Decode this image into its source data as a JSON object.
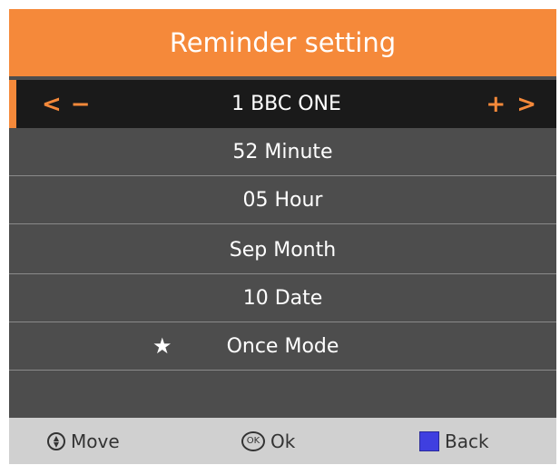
{
  "header": {
    "title": "Reminder setting"
  },
  "rows": {
    "channel": {
      "label": "1 BBC ONE",
      "left_arrow": "<",
      "left_minus": "−",
      "right_plus": "+",
      "right_arrow": ">"
    },
    "minute": "52 Minute",
    "hour": "05 Hour",
    "month": "Sep Month",
    "date": "10 Date",
    "mode": {
      "label": "Once Mode",
      "star": "★"
    }
  },
  "footer": {
    "move": {
      "label": "Move",
      "icon": "up-down-icon"
    },
    "ok": {
      "label": "Ok",
      "icon_text": "OK"
    },
    "back": {
      "label": "Back",
      "color": "#3f3fe0"
    }
  },
  "colors": {
    "accent": "#f5893a",
    "panel": "#4d4d4d",
    "selected": "#1a1a1a",
    "footer": "#d0d0d0"
  }
}
